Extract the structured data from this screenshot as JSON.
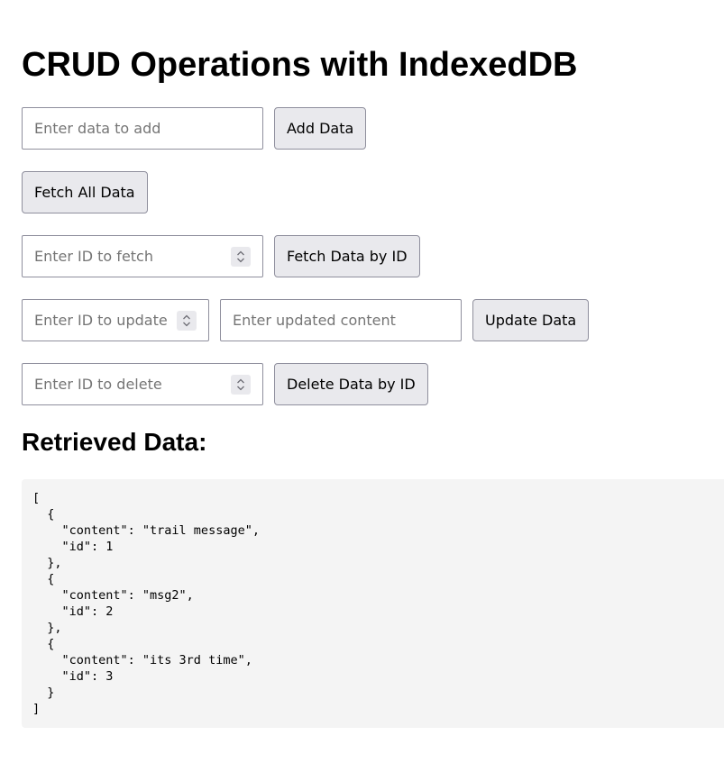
{
  "page": {
    "title": "CRUD Operations with IndexedDB",
    "retrieved_heading": "Retrieved Data:"
  },
  "add": {
    "input_placeholder": "Enter data to add",
    "input_value": "",
    "button_label": "Add Data"
  },
  "fetch_all": {
    "button_label": "Fetch All Data"
  },
  "fetch_by_id": {
    "input_placeholder": "Enter ID to fetch",
    "input_value": "",
    "button_label": "Fetch Data by ID"
  },
  "update": {
    "id_placeholder": "Enter ID to update",
    "id_value": "",
    "content_placeholder": "Enter updated content",
    "content_value": "",
    "button_label": "Update Data"
  },
  "delete": {
    "input_placeholder": "Enter ID to delete",
    "input_value": "",
    "button_label": "Delete Data by ID"
  },
  "output": {
    "text": "[\n  {\n    \"content\": \"trail message\",\n    \"id\": 1\n  },\n  {\n    \"content\": \"msg2\",\n    \"id\": 2\n  },\n  {\n    \"content\": \"its 3rd time\",\n    \"id\": 3\n  }\n]",
    "records": [
      {
        "content": "trail message",
        "id": 1
      },
      {
        "content": "msg2",
        "id": 2
      },
      {
        "content": "its 3rd time",
        "id": 3
      }
    ]
  },
  "icons": {
    "spinner": "spinner-arrows-icon"
  },
  "colors": {
    "button_bg": "#e9e9ed",
    "border": "#8f8f9d",
    "output_bg": "#f4f4f4",
    "placeholder": "#757575"
  }
}
